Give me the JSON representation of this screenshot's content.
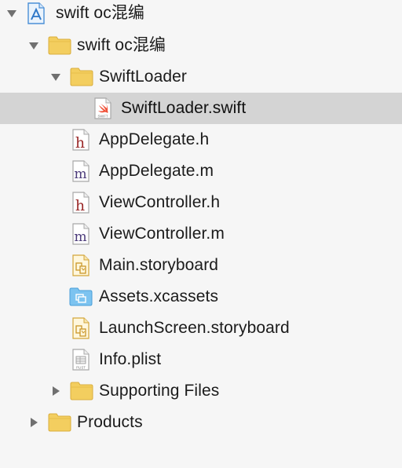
{
  "navigator": {
    "project": {
      "label": "swift oc混编",
      "expanded": true
    },
    "group_main": {
      "label": "swift oc混编",
      "expanded": true
    },
    "group_swiftloader": {
      "label": "SwiftLoader",
      "expanded": true
    },
    "files": {
      "swiftloader_swift": {
        "label": "SwiftLoader.swift",
        "icon": "swift-file-icon",
        "icon_text": "SWIFT",
        "selected": true
      },
      "appdelegate_h": {
        "label": "AppDelegate.h",
        "icon": "header-file-icon",
        "glyph": "h"
      },
      "appdelegate_m": {
        "label": "AppDelegate.m",
        "icon": "objc-file-icon",
        "glyph": "m"
      },
      "viewcontroller_h": {
        "label": "ViewController.h",
        "icon": "header-file-icon",
        "glyph": "h"
      },
      "viewcontroller_m": {
        "label": "ViewController.m",
        "icon": "objc-file-icon",
        "glyph": "m"
      },
      "main_storyboard": {
        "label": "Main.storyboard",
        "icon": "storyboard-file-icon"
      },
      "assets": {
        "label": "Assets.xcassets",
        "icon": "asset-catalog-icon"
      },
      "launchscreen": {
        "label": "LaunchScreen.storyboard",
        "icon": "storyboard-file-icon"
      },
      "info_plist": {
        "label": "Info.plist",
        "icon": "plist-file-icon",
        "icon_text": "PLIST"
      }
    },
    "group_supporting": {
      "label": "Supporting Files",
      "expanded": false
    },
    "group_products": {
      "label": "Products",
      "expanded": false
    }
  },
  "colors": {
    "background": "#f6f6f6",
    "selection": "#d4d4d4",
    "folder": "#f3ce5f",
    "swift": "#f05138",
    "header_glyph": "#9b2b2b",
    "impl_glyph": "#4b3a7a",
    "asset_blue": "#5fb4ea"
  }
}
